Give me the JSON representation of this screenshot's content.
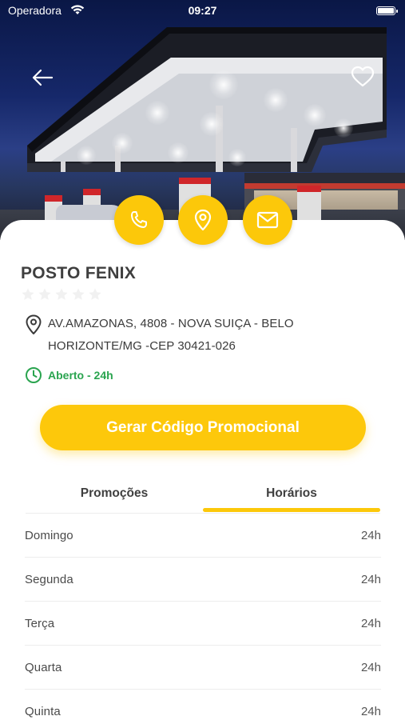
{
  "status_bar": {
    "carrier": "Operadora",
    "time": "09:27"
  },
  "station": {
    "name": "POSTO FENIX",
    "rating": 0,
    "rating_max": 5,
    "address": "AV.AMAZONAS, 4808 - NOVA SUIÇA - BELO HORIZONTE/MG -CEP 30421-026",
    "status": "Aberto - 24h"
  },
  "actions": {
    "phone_icon": "phone-icon",
    "location_icon": "map-pin-icon",
    "email_icon": "envelope-icon"
  },
  "promo_button": {
    "label": "Gerar Código Promocional"
  },
  "tabs": [
    {
      "label": "Promoções",
      "active": false
    },
    {
      "label": "Horários",
      "active": true
    }
  ],
  "hours": [
    {
      "day": "Domingo",
      "value": "24h"
    },
    {
      "day": "Segunda",
      "value": "24h"
    },
    {
      "day": "Terça",
      "value": "24h"
    },
    {
      "day": "Quarta",
      "value": "24h"
    },
    {
      "day": "Quinta",
      "value": "24h"
    }
  ],
  "colors": {
    "accent": "#FCC80A",
    "open_green": "#2AA44F",
    "text_dark": "#3F3F3F"
  }
}
